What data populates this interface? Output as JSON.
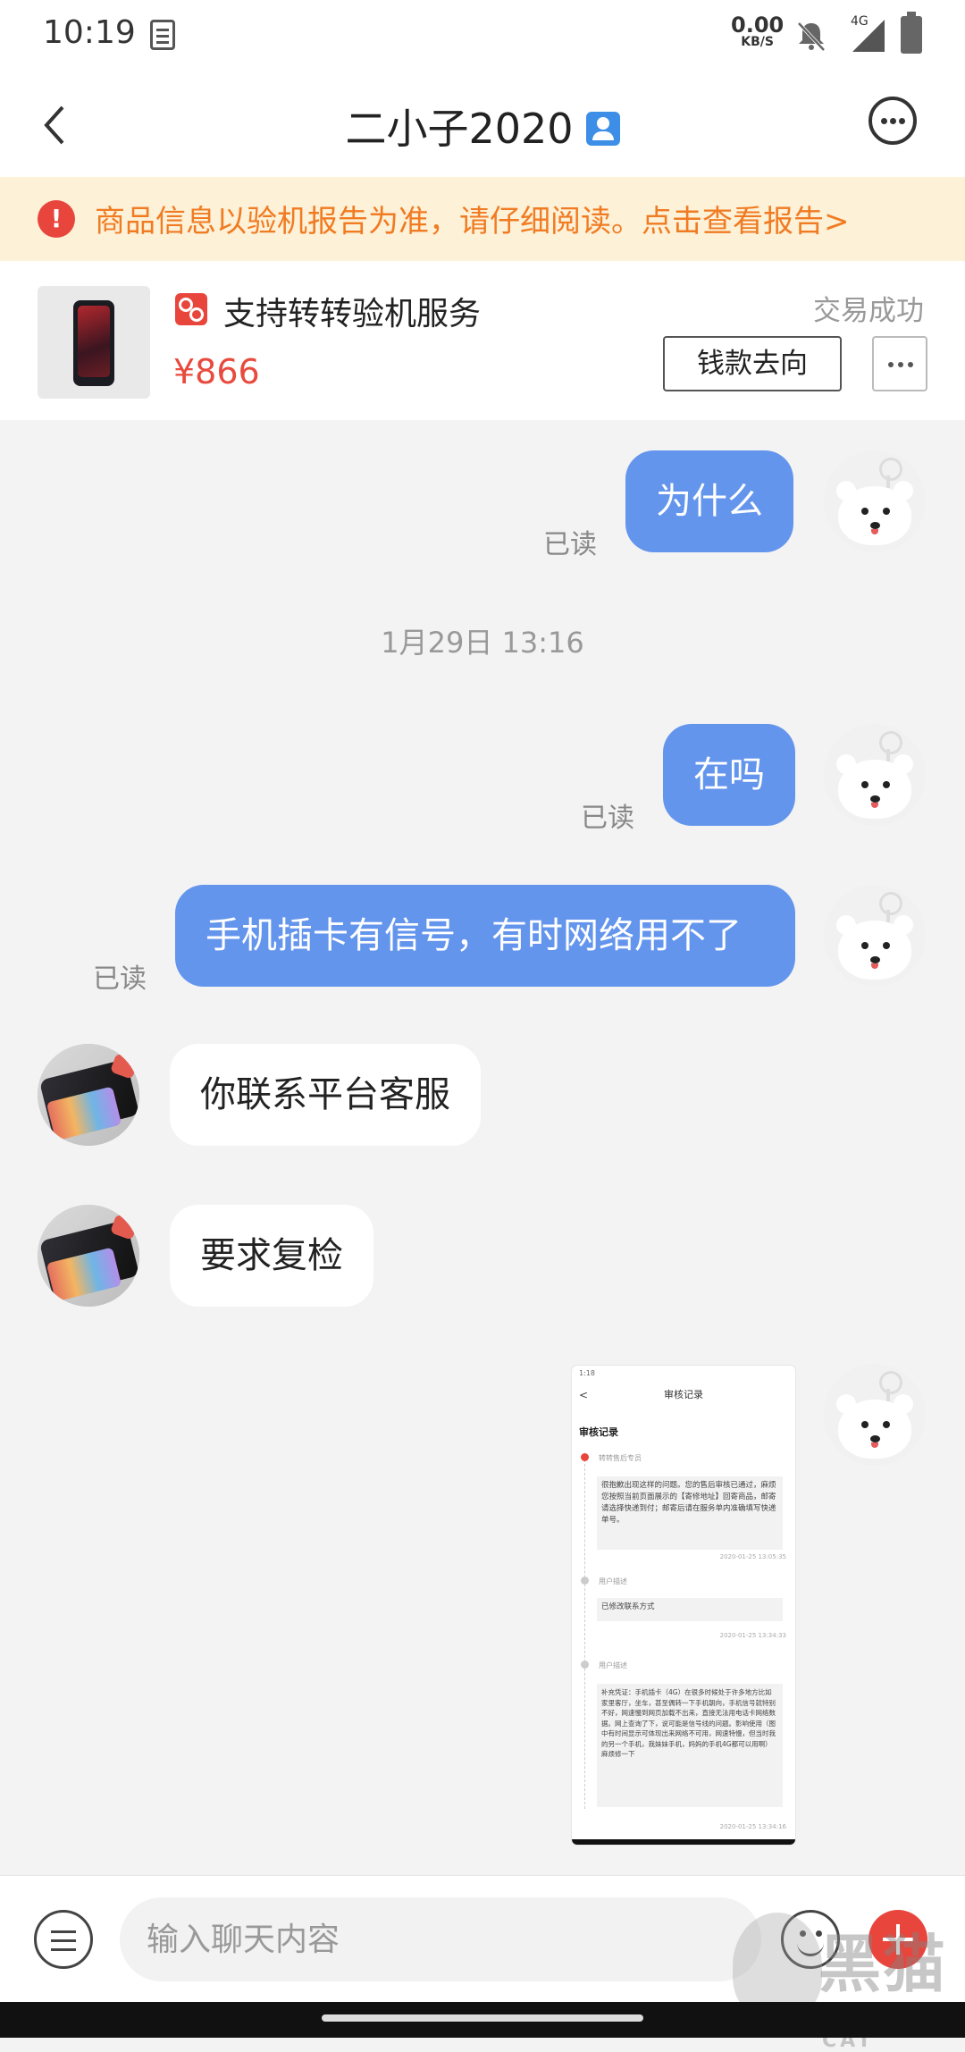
{
  "status_bar": {
    "time": "10:19",
    "net_speed": "0.00",
    "net_unit": "KB/S",
    "network": "4G"
  },
  "nav": {
    "title": "二小子2020",
    "verified_icon": "person-badge-icon",
    "back_icon": "chevron-left-icon",
    "more_icon": "more-horizontal-icon"
  },
  "notice": {
    "icon": "exclamation-icon",
    "text": "商品信息以验机报告为准，请仔细阅读。点击查看报告>"
  },
  "product": {
    "name": "支持转转验机服务",
    "price": "¥866",
    "status": "交易成功",
    "money_button": "钱款去向"
  },
  "messages": {
    "m1": {
      "text": "为什么",
      "read": "已读"
    },
    "timestamp": "1月29日 13:16",
    "m2": {
      "text": "在吗",
      "read": "已读"
    },
    "m3": {
      "text": "手机插卡有信号，有时网络用不了",
      "read": "已读"
    },
    "m4": {
      "text": "你联系平台客服"
    },
    "m5": {
      "text": "要求复检"
    }
  },
  "screenshot_message": {
    "status_time": "1:18",
    "nav_title": "审核记录",
    "heading": "审核记录",
    "entries": [
      {
        "label": "转转售后专员",
        "body": "很抱歉出现这样的问题。您的售后审核已通过，麻烦您按照当前页面展示的【寄修地址】回寄商品，邮寄请选择快递到付；邮寄后请在服务单内准确填写快递单号。",
        "time": "2020-01-25 13:05:35"
      },
      {
        "label": "用户描述",
        "body": "已修改联系方式",
        "time": "2020-01-25 13:34:33"
      },
      {
        "label": "用户描述",
        "body": "补充凭证：手机插卡（4G）在很多时候处于许多地方比如家里客厅，坐车，甚至偶转一下手机朝向，手机信号就特别不好，网速慢到网页加载不出来，直接无法用电话卡网络数据。网上查询了下，说可能是信号线的问题。影响使用（图中有时间显示可体现出来网络不可用，网速特慢，但当时我的另一个手机，我妹妹手机，妈妈的手机4G都可以用啊）麻烦修一下",
        "time": "2020-01-25 13:34:16"
      }
    ]
  },
  "input_bar": {
    "placeholder": "输入聊天内容",
    "menu_icon": "menu-icon",
    "emoji_icon": "emoji-icon",
    "plus_icon": "plus-icon"
  },
  "watermark": {
    "zh": "黑猫",
    "en": "BLACK CAT"
  },
  "colors": {
    "accent_blue": "#6495ed",
    "price_red": "#e84a3d",
    "notice_orange": "#f07b22",
    "notice_bg": "#fdf1d8"
  }
}
